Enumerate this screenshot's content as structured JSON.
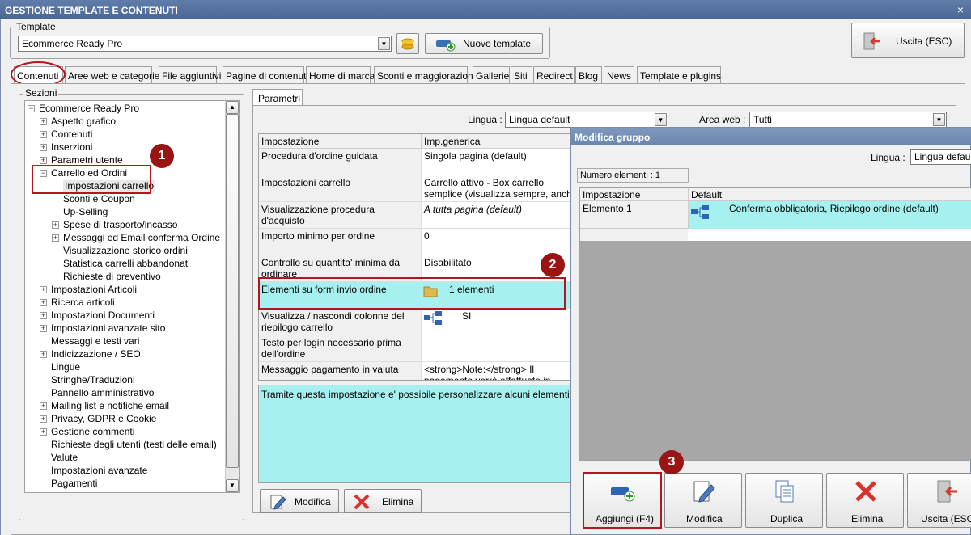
{
  "window": {
    "title": "GESTIONE TEMPLATE E CONTENUTI",
    "close": "×"
  },
  "template_group": {
    "legend": "Template",
    "selected": "Ecommerce Ready Pro",
    "new_button": "Nuovo template"
  },
  "exit_button": "Uscita (ESC)",
  "tabs": [
    "Contenuti",
    "Aree web e categorie",
    "File aggiuntivi",
    "Pagine di contenuti",
    "Home di marca",
    "Sconti e maggiorazioni",
    "Gallerie",
    "Siti",
    "Redirect",
    "Blog",
    "News",
    "Template e plugins"
  ],
  "sections": {
    "legend": "Sezioni",
    "root": "Ecommerce Ready Pro",
    "items": [
      {
        "label": "Aspetto grafico",
        "exp": "+",
        "lvl": 1
      },
      {
        "label": "Contenuti",
        "exp": "+",
        "lvl": 1
      },
      {
        "label": "Inserzioni",
        "exp": "+",
        "lvl": 1
      },
      {
        "label": "Parametri utente",
        "exp": "+",
        "lvl": 1
      },
      {
        "label": "Carrello ed Ordini",
        "exp": "−",
        "lvl": 1
      },
      {
        "label": "Impostazioni carrello",
        "exp": "",
        "lvl": 2
      },
      {
        "label": "Sconti e Coupon",
        "exp": "",
        "lvl": 2
      },
      {
        "label": "Up-Selling",
        "exp": "",
        "lvl": 2
      },
      {
        "label": "Spese di trasporto/incasso",
        "exp": "+",
        "lvl": 2
      },
      {
        "label": "Messaggi ed Email conferma Ordine",
        "exp": "+",
        "lvl": 2
      },
      {
        "label": "Visualizzazione storico ordini",
        "exp": "",
        "lvl": 2
      },
      {
        "label": "Statistica carrelli abbandonati",
        "exp": "",
        "lvl": 2
      },
      {
        "label": "Richieste di preventivo",
        "exp": "",
        "lvl": 2
      },
      {
        "label": "Impostazioni Articoli",
        "exp": "+",
        "lvl": 1
      },
      {
        "label": "Ricerca articoli",
        "exp": "+",
        "lvl": 1
      },
      {
        "label": "Impostazioni Documenti",
        "exp": "+",
        "lvl": 1
      },
      {
        "label": "Impostazioni avanzate sito",
        "exp": "+",
        "lvl": 1
      },
      {
        "label": "Messaggi e testi vari",
        "exp": "",
        "lvl": 1
      },
      {
        "label": "Indicizzazione / SEO",
        "exp": "+",
        "lvl": 1
      },
      {
        "label": "Lingue",
        "exp": "",
        "lvl": 1
      },
      {
        "label": "Stringhe/Traduzioni",
        "exp": "",
        "lvl": 1
      },
      {
        "label": "Pannello amministrativo",
        "exp": "",
        "lvl": 1
      },
      {
        "label": "Mailing list e notifiche email",
        "exp": "+",
        "lvl": 1
      },
      {
        "label": "Privacy, GDPR e Cookie",
        "exp": "+",
        "lvl": 1
      },
      {
        "label": "Gestione commenti",
        "exp": "+",
        "lvl": 1
      },
      {
        "label": "Richieste degli utenti (testi delle email)",
        "exp": "",
        "lvl": 1
      },
      {
        "label": "Valute",
        "exp": "",
        "lvl": 1
      },
      {
        "label": "Impostazioni avanzate",
        "exp": "",
        "lvl": 1
      },
      {
        "label": "Pagamenti",
        "exp": "",
        "lvl": 1
      }
    ]
  },
  "params": {
    "tab": "Parametri",
    "lingua_label": "Lingua :",
    "lingua_value": "Lingua default",
    "area_label": "Area web :",
    "area_value": "Tutti",
    "col_setting": "Impostazione",
    "col_value": "Imp.generica",
    "rows": [
      {
        "setting": "Procedura d'ordine guidata",
        "value": "Singola pagina (default)"
      },
      {
        "setting": "Impostazioni carrello",
        "value": "Carrello attivo - Box carrello semplice (visualizza sempre, anche se vuoto)"
      },
      {
        "setting": "Visualizzazione procedura d'acquisto",
        "value": "A tutta pagina (default)"
      },
      {
        "setting": "Importo minimo per ordine",
        "value": "0"
      },
      {
        "setting": "Controllo su quantita' minima da ordinare",
        "value": "Disabilitato"
      },
      {
        "setting": "Elementi su form invio ordine",
        "value": "1 elementi"
      },
      {
        "setting": "Visualizza / nascondi colonne del riepilogo carrello",
        "value": "SI"
      },
      {
        "setting": "Testo per login necessario prima dell'ordine",
        "value": ""
      },
      {
        "setting": "Messaggio pagamento in valuta",
        "value": "<strong>Note:</strong> Il pagamento verrà effettuato in"
      }
    ],
    "description": "Tramite questa impostazione e' possibile personalizzare alcuni elementi che comp",
    "modify": "Modifica",
    "delete": "Elimina"
  },
  "dialog": {
    "title": "Modifica gruppo",
    "lingua_label": "Lingua :",
    "lingua_value": "Lingua default",
    "count": "Numero elementi : 1",
    "col_setting": "Impostazione",
    "col_default": "Default",
    "row_label": "Elemento 1",
    "row_value": "Conferma obbligatoria, Riepilogo ordine (default)",
    "buttons": [
      "Aggiungi (F4)",
      "Modifica",
      "Duplica",
      "Elimina",
      "Uscita (ESC)"
    ]
  },
  "badges": [
    "1",
    "2",
    "3"
  ]
}
